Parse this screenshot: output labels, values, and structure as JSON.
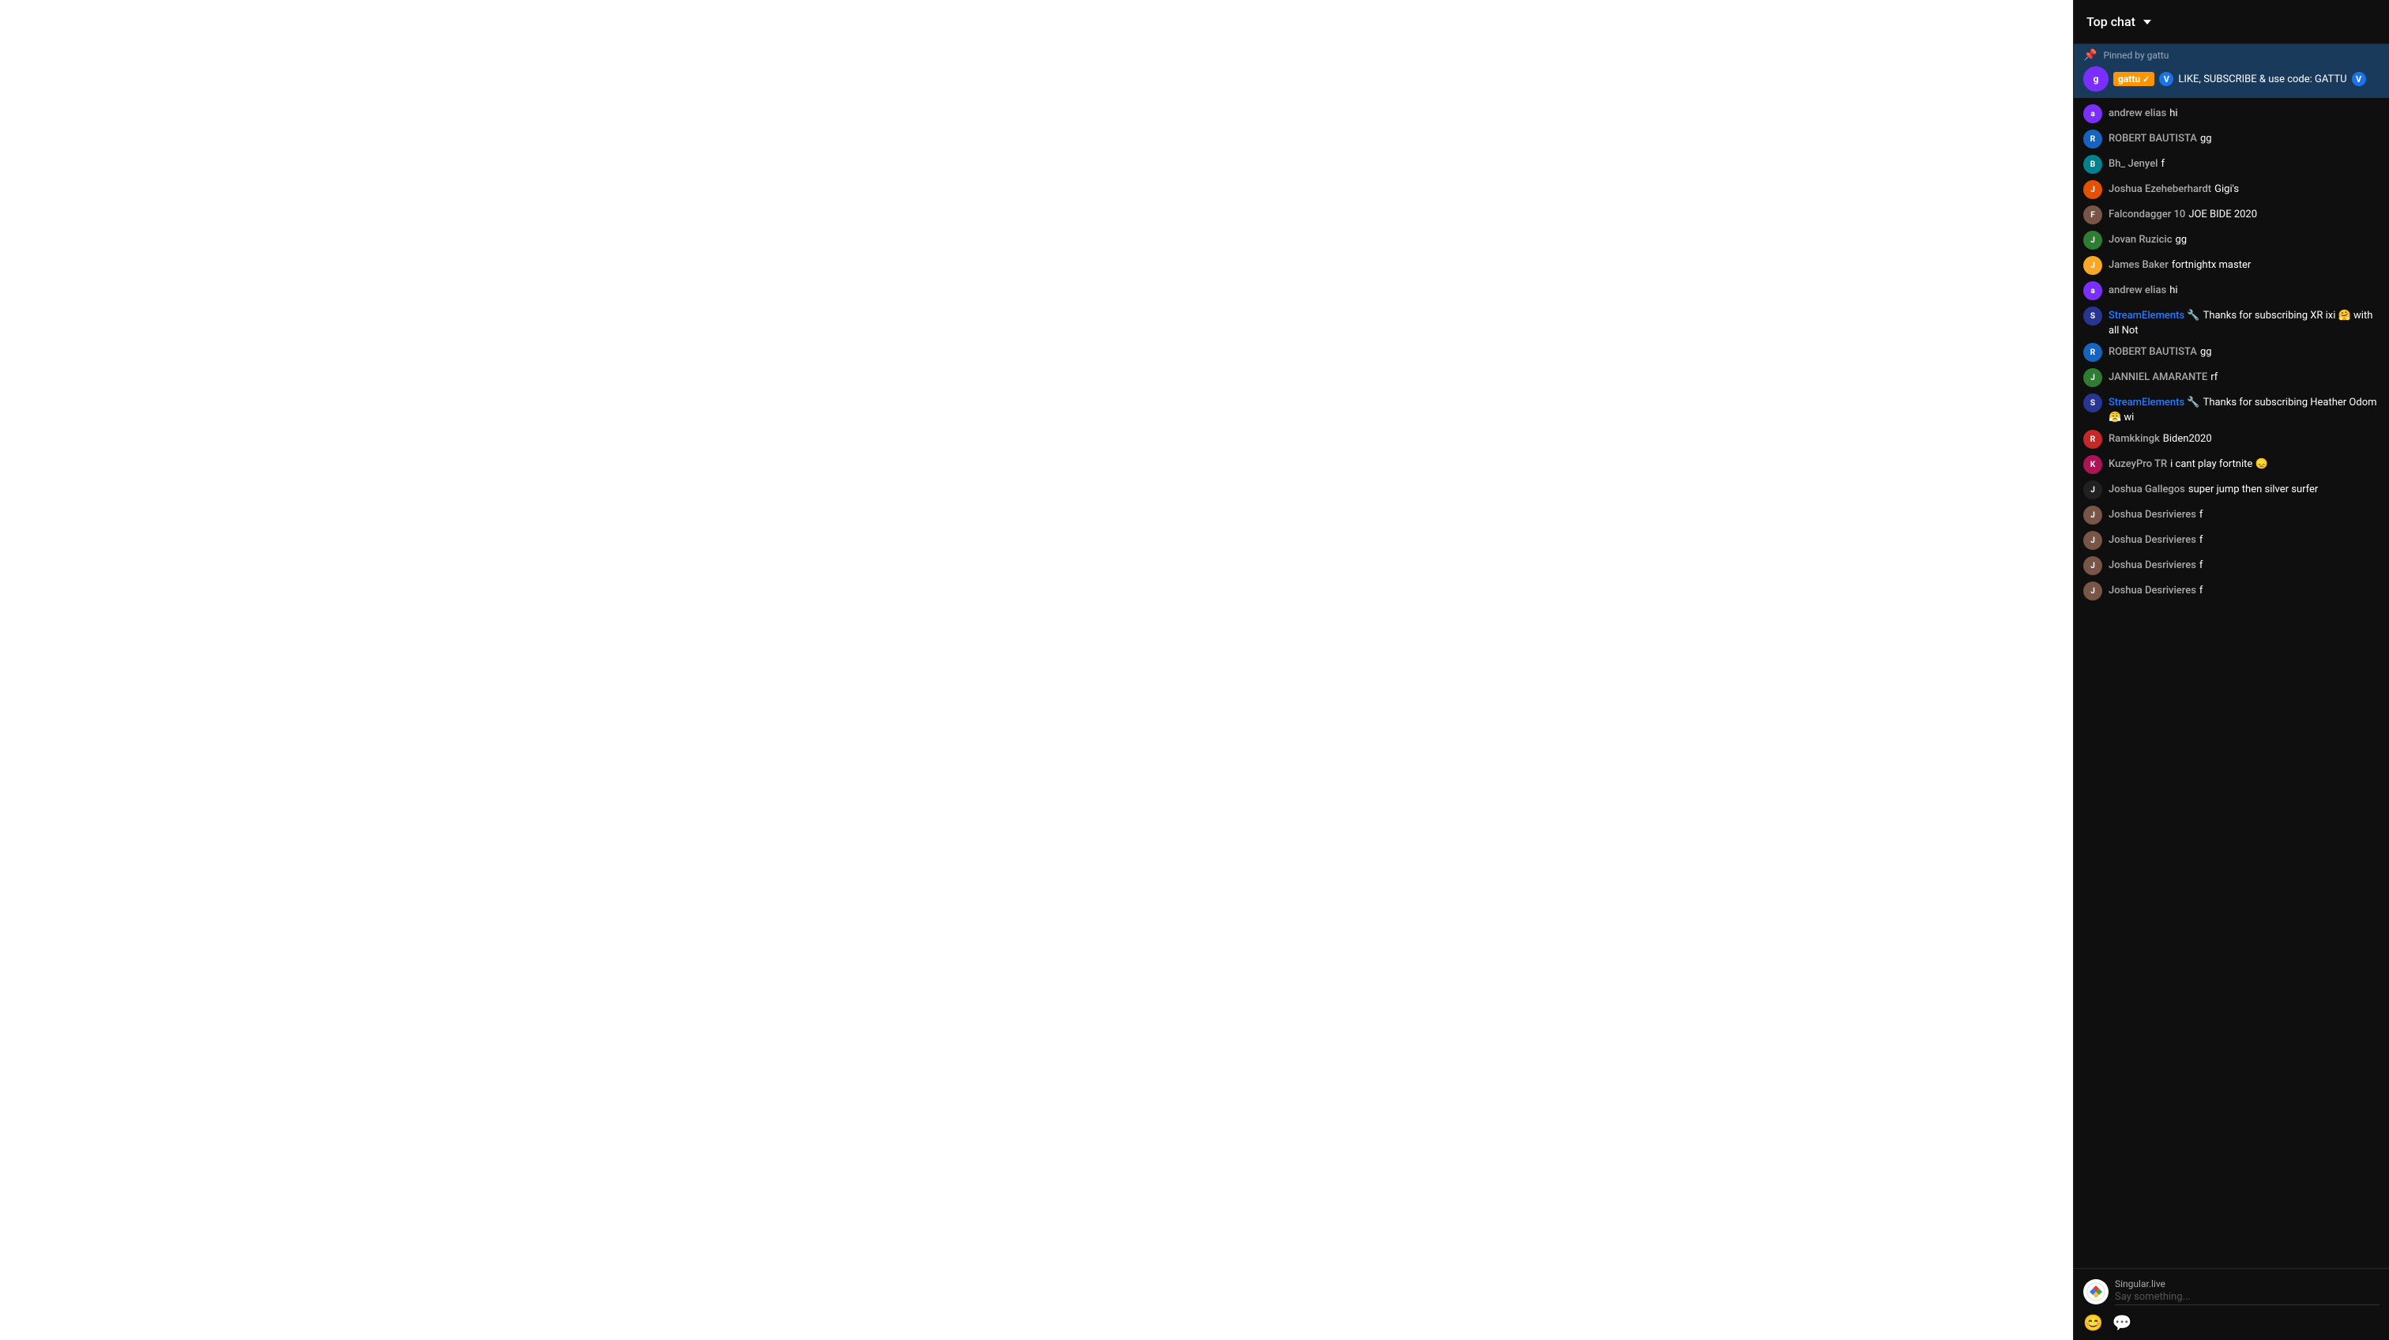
{
  "header": {
    "title": "Top chat",
    "dropdown_label": "Top chat"
  },
  "pinned": {
    "pinned_by": "Pinned by gattu",
    "author": "gattu",
    "checkmark": "✓",
    "verified_icon": "V",
    "message": "LIKE, SUBSCRIBE & use code: GATTU"
  },
  "messages": [
    {
      "id": 1,
      "author": "andrew elias",
      "text": "hi",
      "avatar_color": "av-purple",
      "avatar_letter": "a",
      "is_stream_elements": false
    },
    {
      "id": 2,
      "author": "ROBERT BAUTISTA",
      "text": "gg",
      "avatar_color": "av-blue",
      "avatar_letter": "R",
      "is_stream_elements": false
    },
    {
      "id": 3,
      "author": "Bh_ Jenyel",
      "text": "f",
      "avatar_color": "av-teal",
      "avatar_letter": "B",
      "is_stream_elements": false
    },
    {
      "id": 4,
      "author": "Joshua Ezeheberhardt",
      "text": "Gigi's",
      "avatar_color": "av-orange",
      "avatar_letter": "J",
      "is_stream_elements": false
    },
    {
      "id": 5,
      "author": "Falcondagger 10",
      "text": "JOE BIDE 2020",
      "avatar_color": "av-brown",
      "avatar_letter": "F",
      "is_stream_elements": false
    },
    {
      "id": 6,
      "author": "Jovan Ruzicic",
      "text": "gg",
      "avatar_color": "av-green",
      "avatar_letter": "J",
      "is_stream_elements": false
    },
    {
      "id": 7,
      "author": "James Baker",
      "text": "fortnightx master",
      "avatar_color": "av-gold",
      "avatar_letter": "J",
      "is_stream_elements": false
    },
    {
      "id": 8,
      "author": "andrew elias",
      "text": "hi",
      "avatar_color": "av-purple",
      "avatar_letter": "a",
      "is_stream_elements": false
    },
    {
      "id": 9,
      "author": "StreamElements 🔧",
      "text": "Thanks for subscribing XR ixi 🤗 with all Not",
      "avatar_color": "av-indigo",
      "avatar_letter": "S",
      "is_stream_elements": true
    },
    {
      "id": 10,
      "author": "ROBERT BAUTISTA",
      "text": "gg",
      "avatar_color": "av-blue",
      "avatar_letter": "R",
      "is_stream_elements": false
    },
    {
      "id": 11,
      "author": "JANNIEL AMARANTE",
      "text": "rf",
      "avatar_color": "av-green",
      "avatar_letter": "J",
      "is_stream_elements": false
    },
    {
      "id": 12,
      "author": "StreamElements 🔧",
      "text": "Thanks for subscribing Heather Odom 😤 wi",
      "avatar_color": "av-indigo",
      "avatar_letter": "S",
      "is_stream_elements": true
    },
    {
      "id": 13,
      "author": "Ramkkingk",
      "text": "Biden2020",
      "avatar_color": "av-red",
      "avatar_letter": "R",
      "is_stream_elements": false
    },
    {
      "id": 14,
      "author": "KuzeyPro TR",
      "text": "i cant play fortnite 😞",
      "avatar_color": "av-pink",
      "avatar_letter": "K",
      "is_stream_elements": false
    },
    {
      "id": 15,
      "author": "Joshua Gallegos",
      "text": "super jump then silver surfer",
      "avatar_color": "av-dark",
      "avatar_letter": "J",
      "is_stream_elements": false
    },
    {
      "id": 16,
      "author": "Joshua Desrivieres",
      "text": "f",
      "avatar_color": "av-brown",
      "avatar_letter": "J",
      "is_stream_elements": false
    },
    {
      "id": 17,
      "author": "Joshua Desrivieres",
      "text": "f",
      "avatar_color": "av-brown",
      "avatar_letter": "J",
      "is_stream_elements": false
    },
    {
      "id": 18,
      "author": "Joshua Desrivieres",
      "text": "f",
      "avatar_color": "av-brown",
      "avatar_letter": "J",
      "is_stream_elements": false
    },
    {
      "id": 19,
      "author": "Joshua Desrivieres",
      "text": "f",
      "avatar_color": "av-brown",
      "avatar_letter": "J",
      "is_stream_elements": false
    }
  ],
  "footer": {
    "account_name": "Singular.live",
    "input_placeholder": "Say something...",
    "emoji_icon": "😊",
    "chat_icon": "💬"
  },
  "colors": {
    "background": "#0f0f0f",
    "pinned_bg": "#1a3a5c",
    "text_primary": "#ffffff",
    "text_secondary": "#aaaaaa",
    "stream_elements_color": "#2979ff",
    "border": "#272727"
  }
}
